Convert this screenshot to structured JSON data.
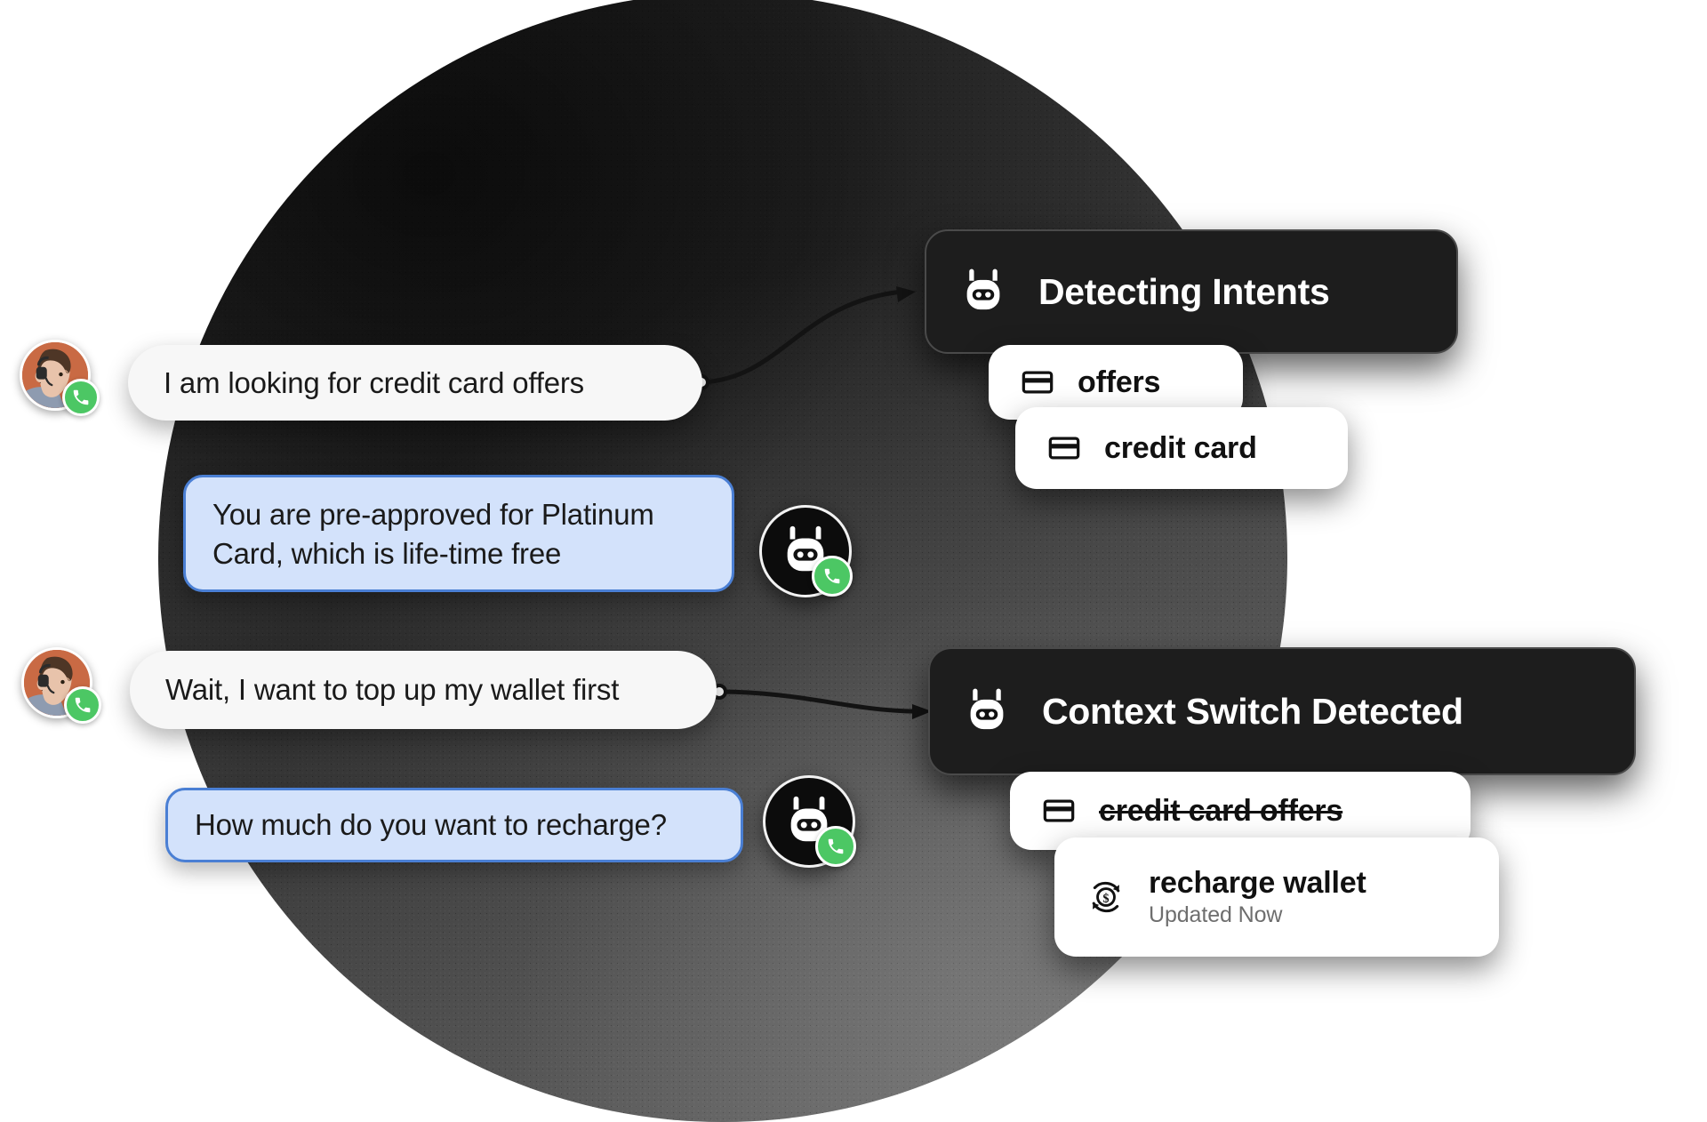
{
  "scene": {
    "title": "AI voice agent conversation intent detection",
    "background_shape": "dark-textured-circle"
  },
  "conversation": {
    "messages": [
      {
        "id": "msg-1",
        "speaker": "user",
        "text": "I am looking for credit card offers",
        "avatar": "user-headset-avatar",
        "status_badge": "phone-icon"
      },
      {
        "id": "msg-2",
        "speaker": "bot",
        "text": "You are pre-approved for Platinum Card, which is life-time free",
        "line1": "You are pre-approved for Platinum",
        "line2": "Card, which is life-time free",
        "avatar": "bot-avatar",
        "status_badge": "phone-icon"
      },
      {
        "id": "msg-3",
        "speaker": "user",
        "text": "Wait, I want to top up my wallet first",
        "avatar": "user-headset-avatar",
        "status_badge": "phone-icon"
      },
      {
        "id": "msg-4",
        "speaker": "bot",
        "text": "How much do you want to recharge?",
        "avatar": "bot-avatar",
        "status_badge": "phone-icon"
      }
    ]
  },
  "panels": [
    {
      "id": "panel-detecting-intents",
      "title": "Detecting Intents",
      "icon": "bot-icon",
      "tags": [
        {
          "label": "offers",
          "icon": "credit-card-icon",
          "struck": false,
          "sub": null
        },
        {
          "label": "credit card",
          "icon": "credit-card-icon",
          "struck": false,
          "sub": null
        }
      ]
    },
    {
      "id": "panel-context-switch",
      "title": "Context Switch Detected",
      "icon": "bot-icon",
      "tags": [
        {
          "label": "credit card offers",
          "icon": "credit-card-icon",
          "struck": true,
          "sub": null
        },
        {
          "label": "recharge wallet",
          "icon": "recharge-money-icon",
          "struck": false,
          "sub": "Updated Now"
        }
      ]
    }
  ],
  "colors": {
    "user_bubble_bg": "#f7f7f7",
    "bot_bubble_bg": "#d3e2fb",
    "bot_bubble_border": "#4a7fd4",
    "card_bg": "#1d1d1d",
    "card_border": "#4a4a4a",
    "pill_bg": "#ffffff",
    "badge_green": "#4cc764",
    "avatar_bg": "#c96a44",
    "sub_text": "#6e6e6e",
    "page_bg": "#ffffff"
  }
}
